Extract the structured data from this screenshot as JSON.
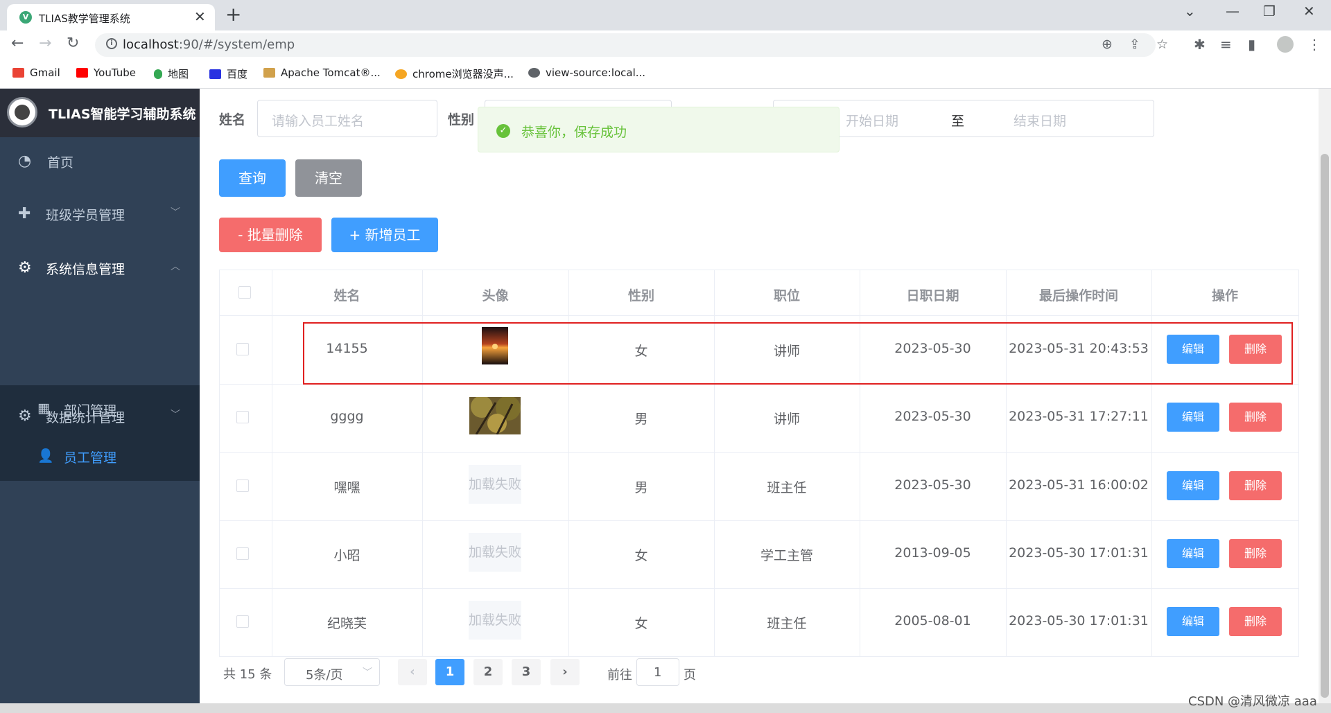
{
  "browser": {
    "tab_title": "TLIAS教学管理系统",
    "tab_favicon": "vue-icon",
    "url_host": "localhost",
    "url_rest": ":90/#/system/emp",
    "bookmarks": [
      "Gmail",
      "YouTube",
      "地图",
      "百度",
      "Apache Tomcat®...",
      "chrome浏览器没声...",
      "view-source:local..."
    ]
  },
  "sidebar": {
    "logo_text": "TLIAS智能学习辅助系统",
    "menu": [
      {
        "label": "首页",
        "icon": "dashboard-icon"
      },
      {
        "label": "班级学员管理",
        "icon": "help-circle-icon"
      },
      {
        "label": "系统信息管理",
        "icon": "gear-icon"
      },
      {
        "label": "数据统计管理",
        "icon": "gear-icon"
      }
    ],
    "submenu": [
      {
        "label": "部门管理",
        "icon": "grid-icon"
      },
      {
        "label": "员工管理",
        "icon": "user-icon"
      }
    ],
    "active_color": "#409eff"
  },
  "filters": {
    "name_label": "姓名",
    "name_placeholder": "请输入员工姓名",
    "gender_label": "性别",
    "start_placeholder": "开始日期",
    "range_sep": "至",
    "end_placeholder": "结束日期"
  },
  "toast": {
    "text": "恭喜你，保存成功",
    "color": "#67c23a"
  },
  "buttons": {
    "query": "查询",
    "clear": "清空",
    "batch_delete": "- 批量删除",
    "add": "+ 新增员工"
  },
  "table": {
    "headers": [
      "姓名",
      "头像",
      "性别",
      "职位",
      "日职日期",
      "最后操作时间",
      "操作"
    ],
    "rows": [
      {
        "name": "14155",
        "avatar": "sunset-photo",
        "gender": "女",
        "job": "讲师",
        "entry": "2023-05-30",
        "updated": "2023-05-31 20:43:53"
      },
      {
        "name": "gggg",
        "avatar": "tree-photo",
        "gender": "男",
        "job": "讲师",
        "entry": "2023-05-30",
        "updated": "2023-05-31 17:27:11"
      },
      {
        "name": "嘿嘿",
        "avatar": "加载失败",
        "gender": "男",
        "job": "班主任",
        "entry": "2023-05-30",
        "updated": "2023-05-31 16:00:02"
      },
      {
        "name": "小昭",
        "avatar": "加载失败",
        "gender": "女",
        "job": "学工主管",
        "entry": "2013-09-05",
        "updated": "2023-05-30 17:01:31"
      },
      {
        "name": "纪晓芙",
        "avatar": "加载失败",
        "gender": "女",
        "job": "班主任",
        "entry": "2005-08-01",
        "updated": "2023-05-30 17:01:31"
      }
    ],
    "edit_label": "编辑",
    "delete_label": "删除"
  },
  "pagination": {
    "total": "共 15 条",
    "page_size": "5条/页",
    "pages": [
      "1",
      "2",
      "3"
    ],
    "current": "1",
    "goto_prefix": "前往",
    "goto_value": "1",
    "goto_suffix": "页"
  },
  "watermark": "CSDN @清风微凉 aaa"
}
